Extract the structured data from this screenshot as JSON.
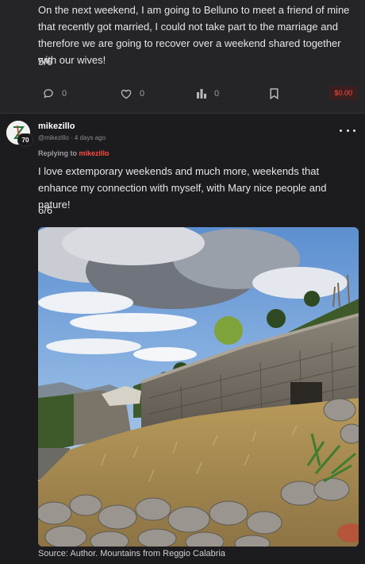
{
  "post1": {
    "text": "On the next weekend, I am going to Belluno to meet a friend of mine that recently got married, I could not take part to the marriage and therefore we are going to recover over a weekend shared together with our wives!",
    "page": "5/6",
    "actions": {
      "comments": "0",
      "likes": "0",
      "views": "0",
      "tip": "$0.00"
    }
  },
  "post2": {
    "username": "mikezillo",
    "handle": "@mikezillo",
    "time": "4 days ago",
    "badge": "70",
    "replying_label": "Replying to",
    "replying_to": "mikezillo",
    "text": "I love extemporary weekends and much more, weekends that enhance my connection with myself, with Mary nice people and nature!",
    "page": "6/6",
    "caption": "Source: Author. Mountains from Reggio Calabria"
  },
  "colors": {
    "accent": "#ff4b3e",
    "background": "#1c1c1f",
    "card": "#252528"
  },
  "icons": [
    "comment-icon",
    "heart-icon",
    "views-icon",
    "bookmark-icon",
    "more-icon"
  ]
}
